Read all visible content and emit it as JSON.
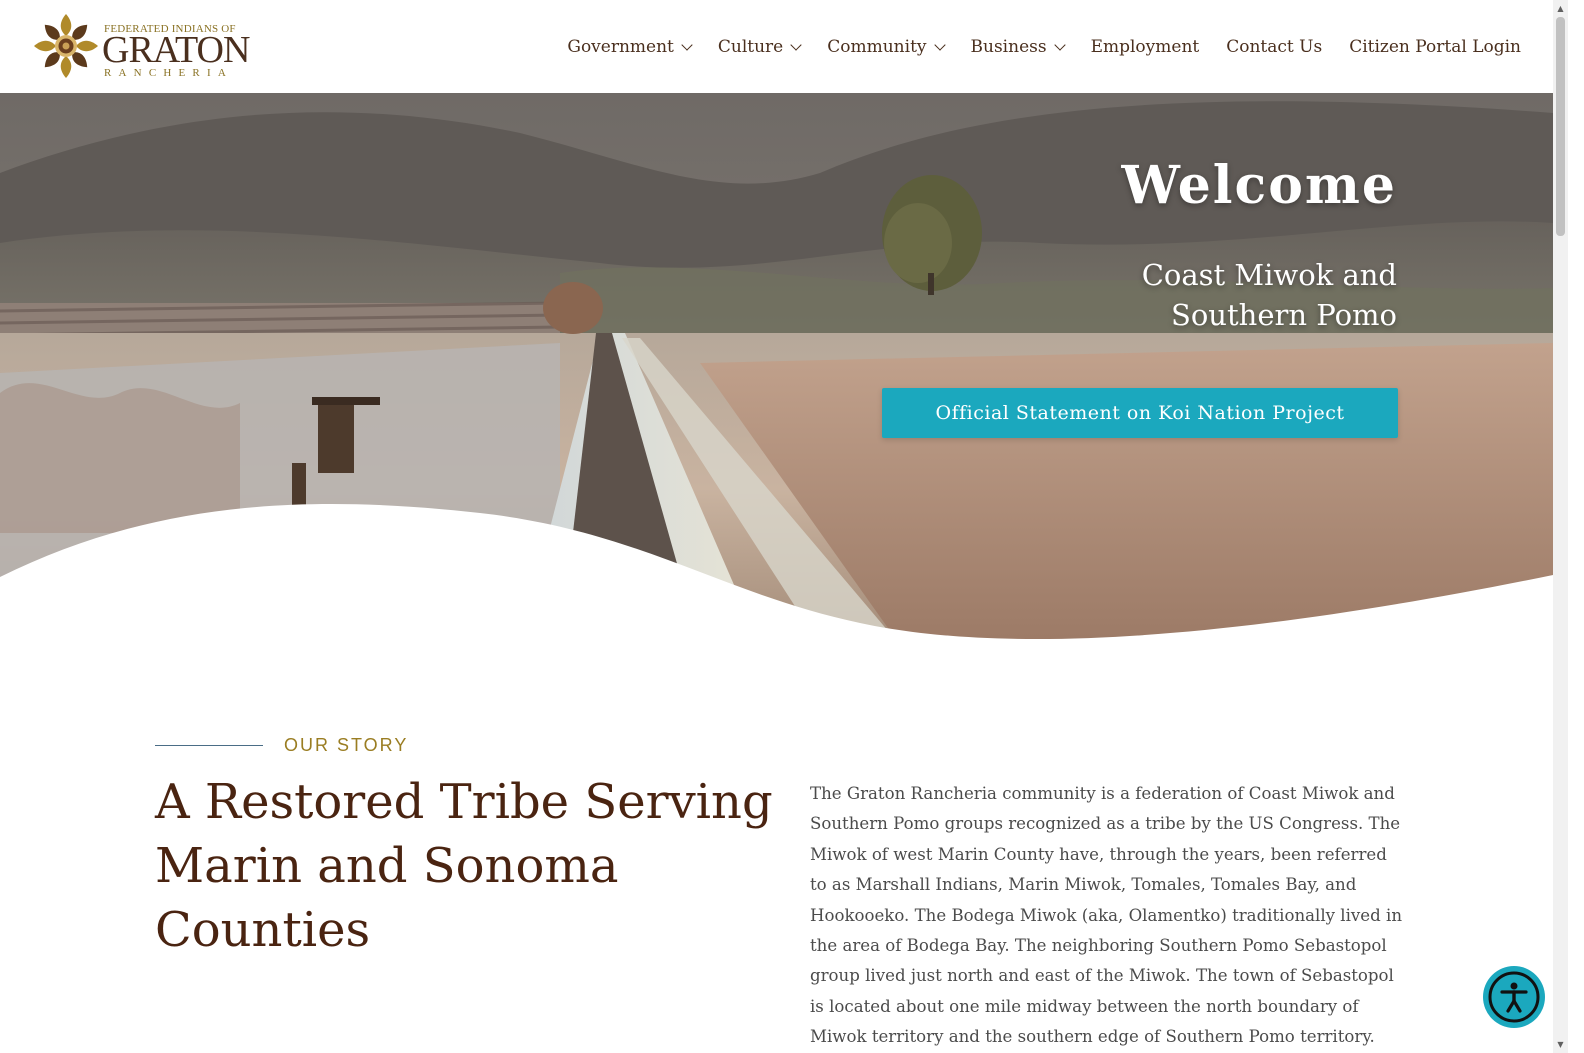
{
  "header": {
    "logo": {
      "top_line": "FEDERATED INDIANS OF",
      "name": "GRATON",
      "sub_line": "RANCHERIA"
    },
    "nav": [
      {
        "label": "Government",
        "has_dropdown": true
      },
      {
        "label": "Culture",
        "has_dropdown": true
      },
      {
        "label": "Community",
        "has_dropdown": true
      },
      {
        "label": "Business",
        "has_dropdown": true
      },
      {
        "label": "Employment",
        "has_dropdown": false
      },
      {
        "label": "Contact Us",
        "has_dropdown": false
      },
      {
        "label": "Citizen Portal Login",
        "has_dropdown": false
      }
    ]
  },
  "hero": {
    "title": "Welcome",
    "subtitle": "Coast Miwok and Southern Pomo",
    "cta_label": "Official Statement on Koi Nation Project"
  },
  "story": {
    "eyebrow": "OUR STORY",
    "title": "A Restored Tribe Serving Marin and Sonoma Counties",
    "body": "The Graton Rancheria community is a federation of Coast Miwok and Southern Pomo groups recognized as a tribe by the US Congress. The Miwok of west Marin County have, through the years, been referred to as Marshall Indians, Marin Miwok, Tomales, Tomales Bay, and Hookooeko. The Bodega Miwok (aka, Olamentko) traditionally lived in the area of Bodega Bay. The neighboring Southern Pomo Sebastopol group lived just north and east of the Miwok. The town of Sebastopol is located about one mile midway between the north boundary of Miwok territory and the southern edge of Southern Pomo territory."
  },
  "accessibility": {
    "icon": "accessibility-icon"
  },
  "colors": {
    "brand_brown": "#4a2f1e",
    "gold": "#9a7d22",
    "teal": "#1ba8be"
  }
}
